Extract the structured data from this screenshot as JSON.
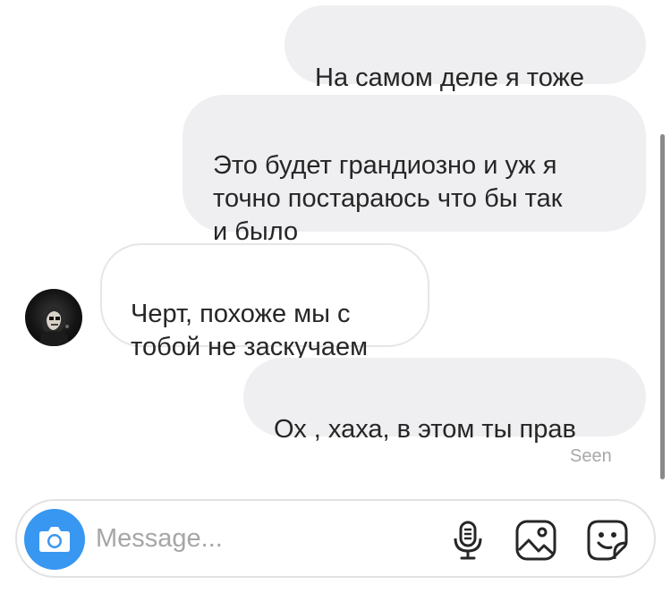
{
  "thread": {
    "messages": [
      {
        "direction": "outgoing",
        "text": "На самом деле я тоже"
      },
      {
        "direction": "outgoing",
        "text": "Это будет грандиозно и уж я\nточно постараюсь что бы так\nи было"
      },
      {
        "direction": "incoming",
        "text": "Черт, похоже мы с\nтобой не заскучаем"
      },
      {
        "direction": "outgoing",
        "text": "Ох , хаха, в этом ты прав"
      }
    ],
    "seen_label": "Seen"
  },
  "composer": {
    "placeholder": "Message...",
    "icons": [
      "camera-icon",
      "microphone-icon",
      "gallery-icon",
      "sticker-icon"
    ]
  },
  "colors": {
    "outgoing_bubble": "#efeff1",
    "incoming_border": "#e6e6e6",
    "camera_button": "#3897f0",
    "text": "#262626",
    "meta_text": "#a8a8a8"
  }
}
